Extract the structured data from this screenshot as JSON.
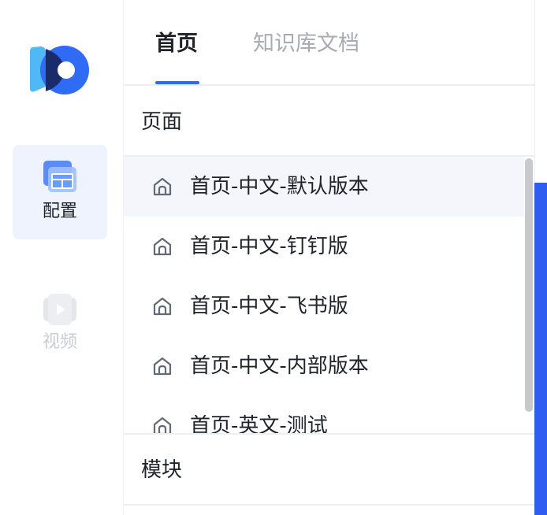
{
  "nav": {
    "logo_icon": "product-logo",
    "items": [
      {
        "label": "配置",
        "icon": "config-icon",
        "active": true
      },
      {
        "label": "视频",
        "icon": "video-icon",
        "active": false
      }
    ]
  },
  "tabs": [
    {
      "label": "首页",
      "active": true
    },
    {
      "label": "知识库文档",
      "active": false
    }
  ],
  "pages_section": {
    "title": "页面",
    "items": [
      {
        "label": "首页-中文-默认版本",
        "icon": "home-icon",
        "selected": true
      },
      {
        "label": "首页-中文-钉钉版",
        "icon": "home-icon",
        "selected": false
      },
      {
        "label": "首页-中文-飞书版",
        "icon": "home-icon",
        "selected": false
      },
      {
        "label": "首页-中文-内部版本",
        "icon": "home-icon",
        "selected": false
      },
      {
        "label": "首页-英文-测试",
        "icon": "home-icon",
        "selected": false
      }
    ]
  },
  "modules_section": {
    "title": "模块"
  },
  "colors": {
    "accent": "#2f6bf5",
    "selected_row": "#f4f6fc",
    "active_nav": "#eff3fe",
    "right_accent": "#2f5df2"
  }
}
